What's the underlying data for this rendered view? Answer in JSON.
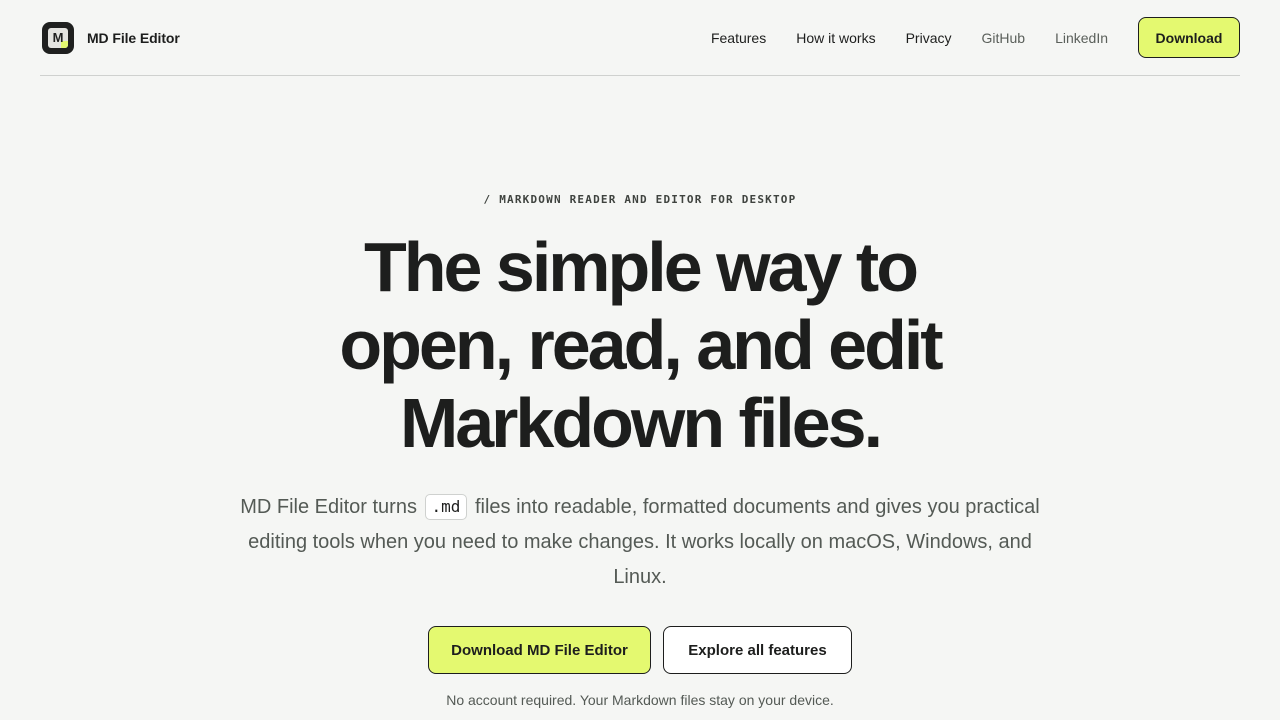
{
  "header": {
    "brand": {
      "logo_letter": "M",
      "name": "MD File Editor"
    },
    "nav": {
      "features": "Features",
      "how_it_works": "How it works",
      "privacy": "Privacy",
      "github": "GitHub",
      "linkedin": "LinkedIn"
    },
    "download_label": "Download"
  },
  "hero": {
    "eyebrow": "/ MARKDOWN READER AND EDITOR FOR DESKTOP",
    "headline": {
      "line1": "The simple way to",
      "line2": "open, read, and edit",
      "line3": "Markdown files."
    },
    "lead": {
      "before_code": "MD File Editor turns",
      "code": ".md",
      "after_code": "files into readable, formatted documents and gives you practical editing tools when you need to make changes. It works locally on macOS, Windows, and Linux."
    },
    "cta_primary": "Download MD File Editor",
    "cta_secondary": "Explore all features",
    "footnote": "No account required. Your Markdown files stay on your device."
  },
  "colors": {
    "background": "#f5f6f4",
    "accent": "#e4f970",
    "text": "#1d1e1d",
    "muted_text": "#545a55"
  },
  "icons": {
    "logo": "md-file-logo-icon"
  }
}
